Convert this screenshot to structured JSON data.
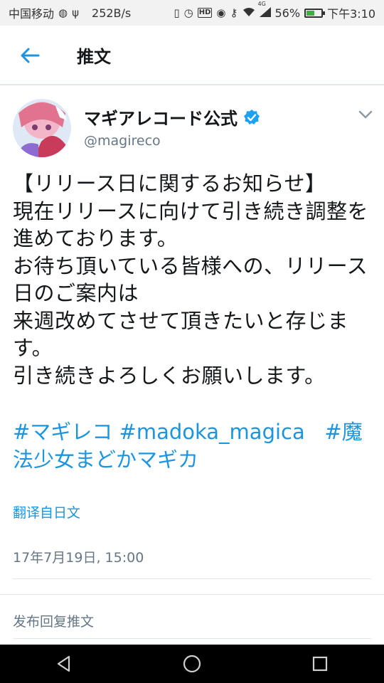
{
  "status_bar": {
    "carrier": "中国移动",
    "speed": "252B/s",
    "network": "4G",
    "battery_percent_label": "56%",
    "battery_level": 0.56,
    "time": "下午3:10"
  },
  "header": {
    "title": "推文"
  },
  "tweet": {
    "author_name": "マギアレコード公式",
    "author_handle": "@magireco",
    "text": "【リリース日に関するお知らせ】\n現在リリースに向けて引き続き調整を進めております。\nお待ち頂いている皆様への、リリース日のご案内は\n来週改めてさせて頂きたいと存じます。\n引き続きよろしくお願いします。",
    "hashtags": [
      "#マギレコ",
      "#madoka_magica",
      "#魔法少女まどかマギカ"
    ],
    "translate_label": "翻译自日文",
    "timestamp": "17年7月19日, 15:00"
  },
  "reply": {
    "placeholder": "发布回复推文"
  },
  "colors": {
    "accent": "#1b95e0",
    "text": "#14171a",
    "secondary": "#657786",
    "divider": "#e1e8ed"
  },
  "icons": {
    "back": "arrow-left-icon",
    "verified": "verified-badge-icon",
    "more": "chevron-down-icon",
    "nav": [
      "back-triangle-icon",
      "home-circle-icon",
      "recents-square-icon"
    ]
  }
}
